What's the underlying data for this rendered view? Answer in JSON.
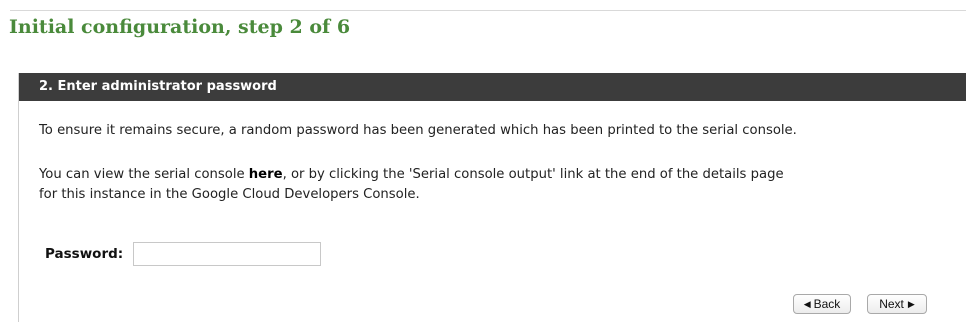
{
  "title": "Initial configuration, step 2 of 6",
  "section": {
    "header": "2. Enter administrator password",
    "paragraph1": "To ensure it remains secure, a random password has been generated which has been printed to the serial console.",
    "paragraph2_prefix": "You can view the serial console ",
    "paragraph2_link": "here",
    "paragraph2_suffix_line1": ", or by clicking the 'Serial console output' link at the end of the details page",
    "paragraph2_line2": "for this instance in the Google Cloud Developers Console."
  },
  "password": {
    "label": "Password:",
    "value": ""
  },
  "buttons": {
    "back_label": "Back",
    "next_label": "Next",
    "back_icon": "triangle-left-icon",
    "next_icon": "triangle-right-icon"
  },
  "colors": {
    "title": "#4a8a3b",
    "header_bg": "#3c3c3c"
  }
}
